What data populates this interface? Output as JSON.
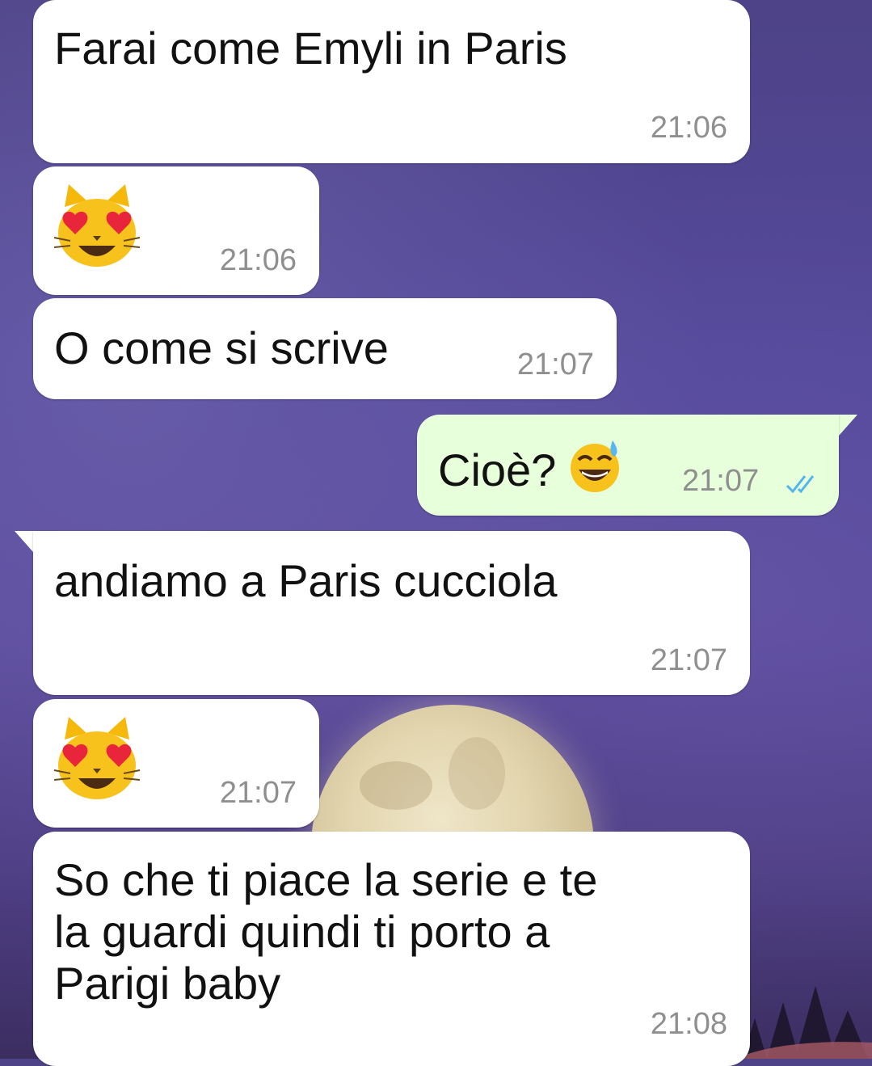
{
  "conversation": {
    "messages": [
      {
        "direction": "incoming",
        "text": "Farai come Emyli in Paris",
        "time": "21:06"
      },
      {
        "direction": "incoming",
        "emoji": "smiling-cat-heart-eyes",
        "time": "21:06"
      },
      {
        "direction": "incoming",
        "text": "O come si scrive",
        "time": "21:07"
      },
      {
        "direction": "outgoing",
        "text": "Cioè?",
        "emoji": "grinning-sweat",
        "time": "21:07",
        "status": "read"
      },
      {
        "direction": "incoming",
        "text": "andiamo a Paris cucciola",
        "time": "21:07"
      },
      {
        "direction": "incoming",
        "emoji": "smiling-cat-heart-eyes",
        "time": "21:07"
      },
      {
        "direction": "incoming",
        "lines": [
          "So che ti piace la serie e te",
          "la guardi quindi ti porto a",
          "Parigi baby"
        ],
        "time": "21:08"
      }
    ]
  },
  "colors": {
    "incoming_bubble": "#ffffff",
    "outgoing_bubble": "#e7ffdb",
    "read_ticks": "#4fb6ec",
    "timestamp": "#8f8f8f"
  },
  "wallpaper": {
    "description_icon": "moon-night-sky"
  }
}
